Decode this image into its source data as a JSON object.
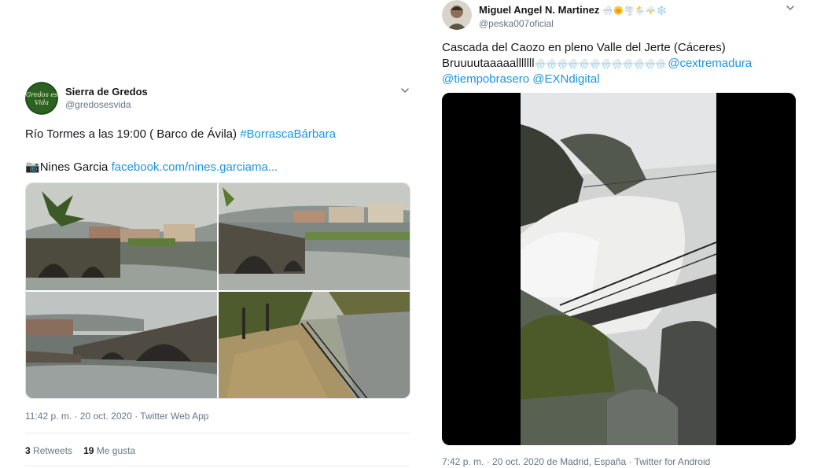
{
  "tweet_left": {
    "display_name": "Sierra de Gredos",
    "handle": "@gredosesvida",
    "avatar_text_line1": "Gredos es",
    "avatar_text_line2": "Vida",
    "line1_text": "Río Tormes a las 19:00 ( Barco de Ávila) ",
    "line1_hashtag": "#BorrascaBárbara",
    "line2_icon": "📷",
    "line2_text": "Nines Garcia ",
    "line2_link": "facebook.com/nines.garciama...",
    "timestamp": "11:42 p. m. · 20 oct. 2020 · Twitter Web App",
    "retweets_count": "3",
    "retweets_label": "Retweets",
    "likes_count": "19",
    "likes_label": "Me gusta",
    "photos": [
      "river-bridge-photo",
      "bridge-arches-photo",
      "stone-bridge-photo",
      "riverside-path-photo"
    ]
  },
  "tweet_right": {
    "display_name": "Miguel Angel N. Martinez",
    "name_emojis": "🌨️🌞🌪️🌦️🌩️❄️",
    "handle": "@peska007oficial",
    "line1_text": "Cascada del Caozo en pleno Valle del Jerte (Cáceres)",
    "line2_text": "Bruuuutaaaaalllllll",
    "line2_emojis": "🌧️🌧️🌧️🌧️🌧️🌧️🌧️🌧️🌧️🌧️🌧️🌧️ ",
    "mention1": "@cextremadura",
    "mention2": "@tiempobrasero",
    "mention3": "@EXNdigital",
    "timestamp": "7:42 p. m. · 20 oct. 2020 de Madrid, España · Twitter for Android"
  },
  "colors": {
    "link": "#1b95e0",
    "text": "#14171a",
    "secondary": "#657786",
    "divider": "#e6ecf0"
  }
}
